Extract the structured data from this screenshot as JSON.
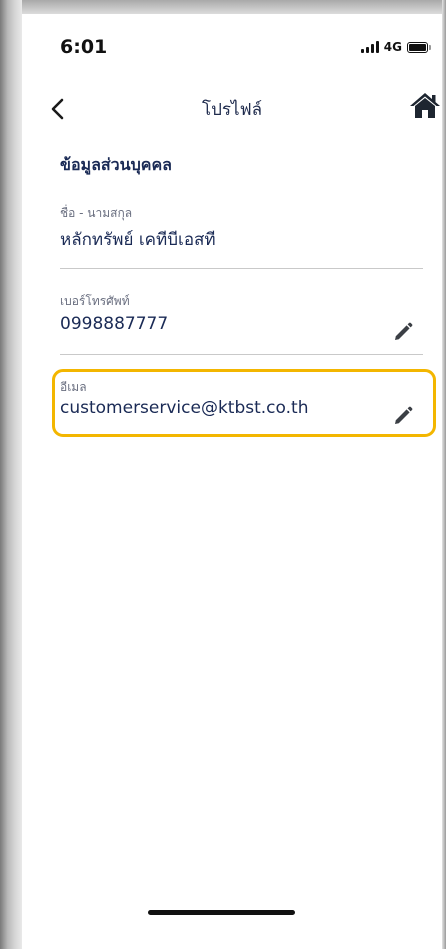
{
  "status_bar": {
    "time": "6:01",
    "network": "4G"
  },
  "header": {
    "title": "โปรไฟล์",
    "back_icon": "chevron-left-icon",
    "home_icon": "home-icon"
  },
  "section": {
    "title": "ข้อมูลส่วนบุคคล"
  },
  "fields": {
    "name": {
      "label": "ชื่อ - นามสกุล",
      "value": "หลักทรัพย์ เคทีบีเอสที"
    },
    "phone": {
      "label": "เบอร์โทรศัพท์",
      "value": "0998887777",
      "edit_icon": "pencil-icon"
    },
    "email": {
      "label": "อีเมล",
      "value": "customerservice@ktbst.co.th",
      "edit_icon": "pencil-icon"
    }
  },
  "colors": {
    "accent_highlight": "#f3b600",
    "text_primary": "#1a2a55",
    "label": "#6a6f80"
  }
}
